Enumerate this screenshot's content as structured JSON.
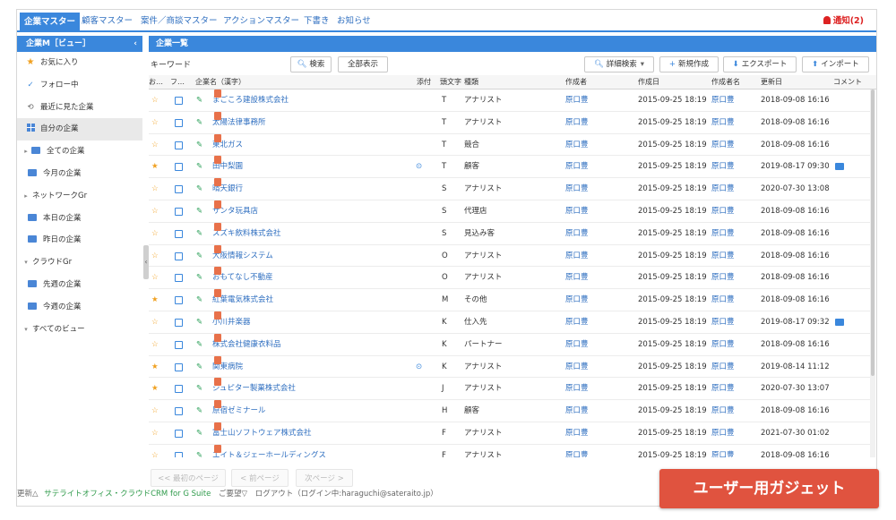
{
  "topnav": {
    "tabs": [
      "企業マスター",
      "顧客マスター",
      "案件／商談マスター",
      "アクションマスター",
      "下書き",
      "お知らせ"
    ],
    "notify": "通知(2)"
  },
  "sidebar": {
    "title": "企業M［ビュー］",
    "items": [
      {
        "label": "お気に入り",
        "icon": "star-icon"
      },
      {
        "label": "フォロー中",
        "icon": "check-icon"
      },
      {
        "label": "最近に見た企業",
        "icon": "history-icon"
      },
      {
        "label": "自分の企業",
        "icon": "grid-icon"
      },
      {
        "label": "全ての企業",
        "icon": "folder-icon"
      },
      {
        "label": "今月の企業",
        "icon": "folder-icon"
      },
      {
        "label": "ネットワークGr",
        "icon": "caret-right-icon"
      },
      {
        "label": "本日の企業",
        "icon": "folder-icon"
      },
      {
        "label": "昨日の企業",
        "icon": "folder-icon"
      },
      {
        "label": "クラウドGr",
        "icon": "caret-down-icon"
      },
      {
        "label": "先週の企業",
        "icon": "folder-icon"
      },
      {
        "label": "今週の企業",
        "icon": "folder-icon"
      },
      {
        "label": "すべてのビュー",
        "icon": "caret-down-icon"
      }
    ]
  },
  "main": {
    "title": "企業一覧",
    "keyword_label": "キーワード",
    "search_btn": "検索",
    "show_all_btn": "全部表示",
    "adv_search_btn": "詳細検索",
    "new_btn": "新規作成",
    "export_btn": "エクスポート",
    "import_btn": "インポート"
  },
  "columns": [
    "お…",
    "フ…",
    "企業名（漢字）",
    "添付",
    "頭文字",
    "種類",
    "作成者",
    "作成日",
    "作成者名",
    "更新日",
    "コメント"
  ],
  "rows": [
    {
      "fav": false,
      "name": "まごころ建設株式会社",
      "attach": false,
      "initial": "T",
      "type": "アナリスト",
      "author": "原口豊",
      "created": "2015-09-25 18:19",
      "user": "原口豊",
      "updated": "2018-09-08 16:16",
      "memo": false
    },
    {
      "fav": false,
      "name": "太陽法律事務所",
      "attach": false,
      "initial": "T",
      "type": "アナリスト",
      "author": "原口豊",
      "created": "2015-09-25 18:19",
      "user": "原口豊",
      "updated": "2018-09-08 16:16",
      "memo": false
    },
    {
      "fav": false,
      "name": "東北ガス",
      "attach": false,
      "initial": "T",
      "type": "競合",
      "author": "原口豊",
      "created": "2015-09-25 18:19",
      "user": "原口豊",
      "updated": "2018-09-08 16:16",
      "memo": false
    },
    {
      "fav": true,
      "name": "田中梨園",
      "attach": true,
      "initial": "T",
      "type": "顧客",
      "author": "原口豊",
      "created": "2015-09-25 18:19",
      "user": "原口豊",
      "updated": "2019-08-17 09:30",
      "memo": true
    },
    {
      "fav": false,
      "name": "晴天銀行",
      "attach": false,
      "initial": "S",
      "type": "アナリスト",
      "author": "原口豊",
      "created": "2015-09-25 18:19",
      "user": "原口豊",
      "updated": "2020-07-30 13:08",
      "memo": false
    },
    {
      "fav": false,
      "name": "サンタ玩具店",
      "attach": false,
      "initial": "S",
      "type": "代理店",
      "author": "原口豊",
      "created": "2015-09-25 18:19",
      "user": "原口豊",
      "updated": "2018-09-08 16:16",
      "memo": false
    },
    {
      "fav": false,
      "name": "スズキ飲料株式会社",
      "attach": false,
      "initial": "S",
      "type": "見込み客",
      "author": "原口豊",
      "created": "2015-09-25 18:19",
      "user": "原口豊",
      "updated": "2018-09-08 16:16",
      "memo": false
    },
    {
      "fav": false,
      "name": "大阪情報システム",
      "attach": false,
      "initial": "O",
      "type": "アナリスト",
      "author": "原口豊",
      "created": "2015-09-25 18:19",
      "user": "原口豊",
      "updated": "2018-09-08 16:16",
      "memo": false
    },
    {
      "fav": false,
      "name": "おもてなし不動産",
      "attach": false,
      "initial": "O",
      "type": "アナリスト",
      "author": "原口豊",
      "created": "2015-09-25 18:19",
      "user": "原口豊",
      "updated": "2018-09-08 16:16",
      "memo": false
    },
    {
      "fav": true,
      "name": "紅葉電気株式会社",
      "attach": false,
      "initial": "M",
      "type": "その他",
      "author": "原口豊",
      "created": "2015-09-25 18:19",
      "user": "原口豊",
      "updated": "2018-09-08 16:16",
      "memo": false
    },
    {
      "fav": false,
      "name": "小川井楽器",
      "attach": false,
      "initial": "K",
      "type": "仕入先",
      "author": "原口豊",
      "created": "2015-09-25 18:19",
      "user": "原口豊",
      "updated": "2019-08-17 09:32",
      "memo": true
    },
    {
      "fav": false,
      "name": "株式会社健康衣料品",
      "attach": false,
      "initial": "K",
      "type": "パートナー",
      "author": "原口豊",
      "created": "2015-09-25 18:19",
      "user": "原口豊",
      "updated": "2018-09-08 16:16",
      "memo": false
    },
    {
      "fav": true,
      "name": "関東病院",
      "attach": true,
      "initial": "K",
      "type": "アナリスト",
      "author": "原口豊",
      "created": "2015-09-25 18:19",
      "user": "原口豊",
      "updated": "2019-08-14 11:12",
      "memo": false
    },
    {
      "fav": true,
      "name": "ジュピター製菓株式会社",
      "attach": false,
      "initial": "J",
      "type": "アナリスト",
      "author": "原口豊",
      "created": "2015-09-25 18:19",
      "user": "原口豊",
      "updated": "2020-07-30 13:07",
      "memo": false
    },
    {
      "fav": false,
      "name": "原宿ゼミナール",
      "attach": false,
      "initial": "H",
      "type": "顧客",
      "author": "原口豊",
      "created": "2015-09-25 18:19",
      "user": "原口豊",
      "updated": "2018-09-08 16:16",
      "memo": false
    },
    {
      "fav": false,
      "name": "富士山ソフトウェア株式会社",
      "attach": false,
      "initial": "F",
      "type": "アナリスト",
      "author": "原口豊",
      "created": "2015-09-25 18:19",
      "user": "原口豊",
      "updated": "2021-07-30 01:02",
      "memo": false
    },
    {
      "fav": false,
      "name": "エイト＆ジェーホールディングス",
      "attach": false,
      "initial": "F",
      "type": "アナリスト",
      "author": "原口豊",
      "created": "2015-09-25 18:19",
      "user": "原口豊",
      "updated": "2018-09-08 16:16",
      "memo": false
    }
  ],
  "pager": {
    "first": "<< 最初のページ",
    "prev": "< 前ページ",
    "next": "次ページ >"
  },
  "footer": {
    "update": "更新△",
    "brand": "サテライトオフィス・クラウドCRM for G Suite",
    "request": "ご要望▽",
    "logout": "ログアウト（ログイン中:haraguchi@sateraito.jp）"
  },
  "gadget_label": "ユーザー用ガジェット",
  "colors": {
    "accent": "#3a87dc",
    "link": "#2f6fc0",
    "star": "#f0a020",
    "gadget": "#e0533f"
  }
}
